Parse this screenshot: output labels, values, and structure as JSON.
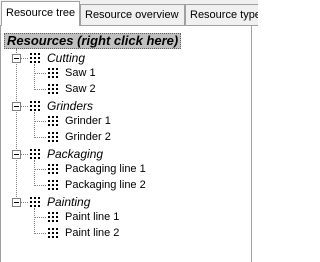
{
  "tabs": [
    {
      "label": "Resource tree",
      "active": true
    },
    {
      "label": "Resource overview",
      "active": false
    },
    {
      "label": "Resource type",
      "active": false
    }
  ],
  "tree": {
    "root_label": "Resources (right click here)",
    "groups": [
      {
        "label": "Cutting",
        "expanded": true,
        "items": [
          "Saw 1",
          "Saw 2"
        ]
      },
      {
        "label": "Grinders",
        "expanded": true,
        "items": [
          "Grinder 1",
          "Grinder 2"
        ]
      },
      {
        "label": "Packaging",
        "expanded": true,
        "items": [
          "Packaging line 1",
          "Packaging line 2"
        ]
      },
      {
        "label": "Painting",
        "expanded": true,
        "items": [
          "Paint line 1",
          "Paint line 2"
        ]
      }
    ],
    "group_icon": "grid-icon",
    "item_icon": "grid-icon",
    "expander_icon": "minus-box-icon"
  },
  "colors": {
    "tab_background": "#f0f0f0",
    "border": "#a0a0a0",
    "root_highlight": "#c0c0c0",
    "tree_lines": "#808080"
  }
}
